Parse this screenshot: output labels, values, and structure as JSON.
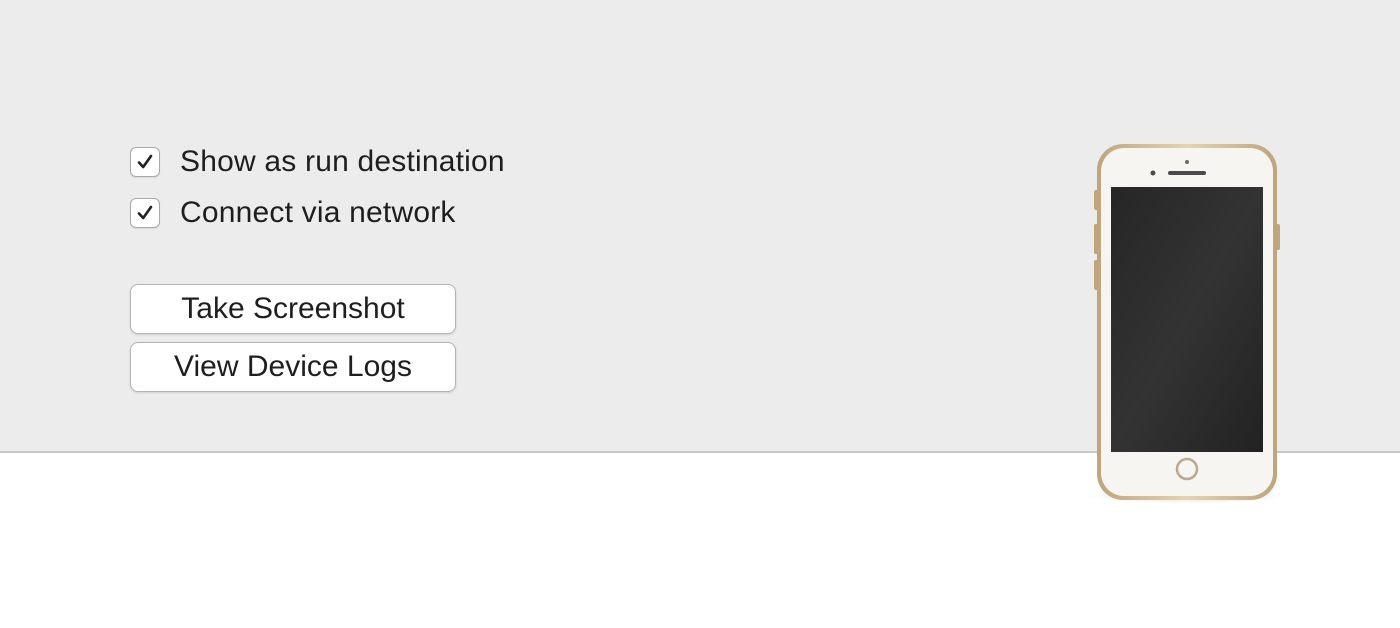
{
  "options": {
    "show_run_destination": {
      "label": "Show as run destination",
      "checked": true
    },
    "connect_via_network": {
      "label": "Connect via network",
      "checked": true
    }
  },
  "actions": {
    "take_screenshot_label": "Take Screenshot",
    "view_device_logs_label": "View Device Logs"
  },
  "device_image": {
    "icon": "iphone-device-icon",
    "frame_color": "#d9c3a0",
    "screen_color": "#2b2b2b"
  },
  "colors": {
    "panel_background": "#ececec",
    "lower_background": "#ffffff",
    "divider": "#c9c9c9"
  }
}
